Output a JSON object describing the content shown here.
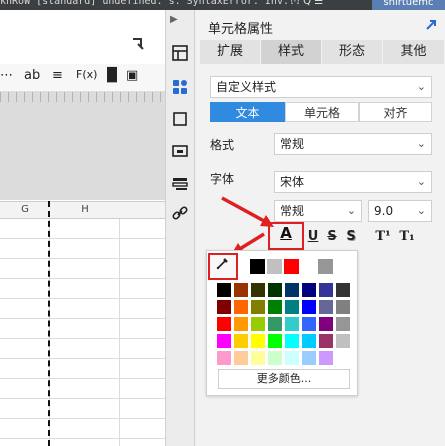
{
  "topbar": {
    "text": "knRoW [standard] undefined. s. SyntaxError. Inv...",
    "icons": "⋯  Q  ☰",
    "tab_label": "shirtuemc"
  },
  "editor": {
    "collapse_icon": "chevron-left-arrow-icon",
    "toolbar": [
      "ab",
      "≡",
      "F(x)",
      "▐▌",
      "▣"
    ],
    "columns": [
      "G",
      "H"
    ]
  },
  "strip": {
    "items": [
      "layout-icon",
      "style-icon",
      "border-icon",
      "widget-icon",
      "data-icon",
      "link-icon"
    ]
  },
  "panel": {
    "title": "单元格属性",
    "tabs": [
      "扩展",
      "样式",
      "形态",
      "其他"
    ],
    "active_tab": "样式",
    "style_select": "自定义样式",
    "segments": [
      "文本",
      "单元格",
      "对齐"
    ],
    "active_segment": "文本",
    "format_label": "格式",
    "format_value": "常规",
    "font_label": "字体",
    "font_value": "宋体",
    "font_style_value": "常规",
    "font_size_value": "9.0",
    "format_buttons": {
      "color": "A",
      "underline": "U",
      "strike": "S",
      "shadow": "S",
      "superscript": "T¹",
      "subscript": "T₁"
    }
  },
  "color_picker": {
    "eyedropper_icon": "eyedropper-icon",
    "recent_colors": [
      "#000000",
      "#c0c0c0",
      "#ff0000",
      "#ffffff",
      "#969696",
      "#ffffff"
    ],
    "palette": [
      [
        "#000000",
        "#993300",
        "#333300",
        "#003300",
        "#003366",
        "#000080",
        "#333399",
        "#333333"
      ],
      [
        "#800000",
        "#ff6600",
        "#808000",
        "#008000",
        "#008080",
        "#0000ff",
        "#666699",
        "#808080"
      ],
      [
        "#ff0000",
        "#ff9900",
        "#99cc00",
        "#339966",
        "#33cccc",
        "#3366ff",
        "#800080",
        "#969696"
      ],
      [
        "#ff00ff",
        "#ffcc00",
        "#ffff00",
        "#00ff00",
        "#00ffff",
        "#00ccff",
        "#993366",
        "#c0c0c0"
      ],
      [
        "#ff99cc",
        "#ffcc99",
        "#ffff99",
        "#ccffcc",
        "#ccffff",
        "#99ccff",
        "#cc99ff",
        "#ffffff"
      ]
    ],
    "more_label": "更多颜色..."
  },
  "colors": {
    "accent": "#2f8ae0",
    "highlight": "#e02020"
  }
}
